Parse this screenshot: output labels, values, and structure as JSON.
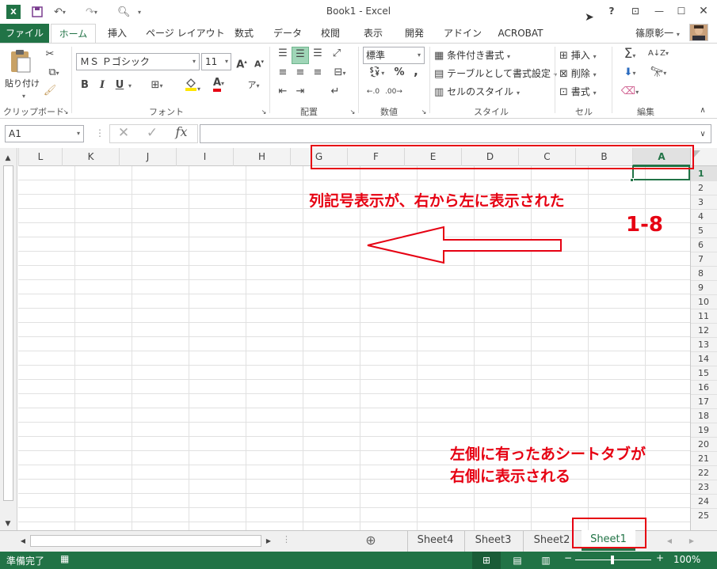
{
  "window": {
    "title": "Book1 - Excel",
    "help": "?",
    "user": "篠原彰一"
  },
  "tabs": [
    "ファイル",
    "ホーム",
    "挿入",
    "ページ レイアウト",
    "数式",
    "データ",
    "校閲",
    "表示",
    "開発",
    "アドイン",
    "ACROBAT"
  ],
  "ribbon": {
    "clipboard": {
      "paste": "貼り付け",
      "label": "クリップボード"
    },
    "font": {
      "name": "ＭＳ Ｐゴシック",
      "size": "11",
      "bold": "B",
      "italic": "I",
      "underline": "U",
      "color_a": "A",
      "label": "フォント"
    },
    "alignment": {
      "label": "配置"
    },
    "number": {
      "format": "標準",
      "percent": "%",
      "comma": ",",
      "label": "数値"
    },
    "styles": {
      "conditional": "条件付き書式",
      "table": "テーブルとして書式設定",
      "cell": "セルのスタイル",
      "label": "スタイル"
    },
    "cells": {
      "insert": "挿入",
      "delete": "削除",
      "format": "書式",
      "label": "セル"
    },
    "editing": {
      "label": "編集"
    }
  },
  "formula_bar": {
    "name_box": "A1",
    "fx": "fx",
    "value": ""
  },
  "columns": [
    "L",
    "K",
    "J",
    "I",
    "H",
    "G",
    "F",
    "E",
    "D",
    "C",
    "B",
    "A"
  ],
  "selected_column": "A",
  "rows": [
    "1",
    "2",
    "3",
    "4",
    "5",
    "6",
    "7",
    "8",
    "9",
    "10",
    "11",
    "12",
    "13",
    "14",
    "15",
    "16",
    "17",
    "18",
    "19",
    "20",
    "21",
    "22",
    "23",
    "24",
    "25"
  ],
  "selected_row": "1",
  "sheets": [
    "Sheet4",
    "Sheet3",
    "Sheet2",
    "Sheet1"
  ],
  "active_sheet": "Sheet1",
  "status": {
    "ready": "準備完了",
    "zoom": "100%"
  },
  "annotations": {
    "col_note": "列記号表示が、右から左に表示された",
    "step": "1-8",
    "tab_note_line1": "左側に有ったあシートタブが",
    "tab_note_line2": "右側に表示される"
  },
  "colors": {
    "excel_green": "#217346",
    "annotation_red": "#e60012"
  }
}
